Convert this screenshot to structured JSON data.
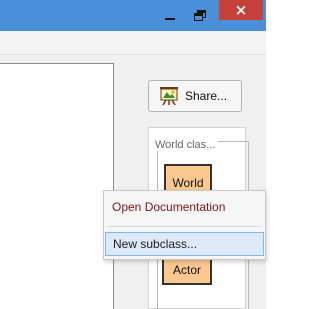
{
  "window": {
    "minimize_icon": "minimize-icon",
    "maximize_icon": "restore-icon",
    "close_icon": "close-icon",
    "close_glyph": "×",
    "close_color": "#c7403a",
    "titlebar_color": "#4a8fd8"
  },
  "toolbar": {
    "share_label": "Share...",
    "share_icon": "easel-icon"
  },
  "class_diagram": {
    "group_title": "World clas...",
    "nodes": [
      "World",
      "Actor"
    ],
    "node_color": "#fbc98f"
  },
  "context_menu": {
    "items": [
      "Open Documentation",
      "New subclass..."
    ],
    "selected_index": 1
  }
}
